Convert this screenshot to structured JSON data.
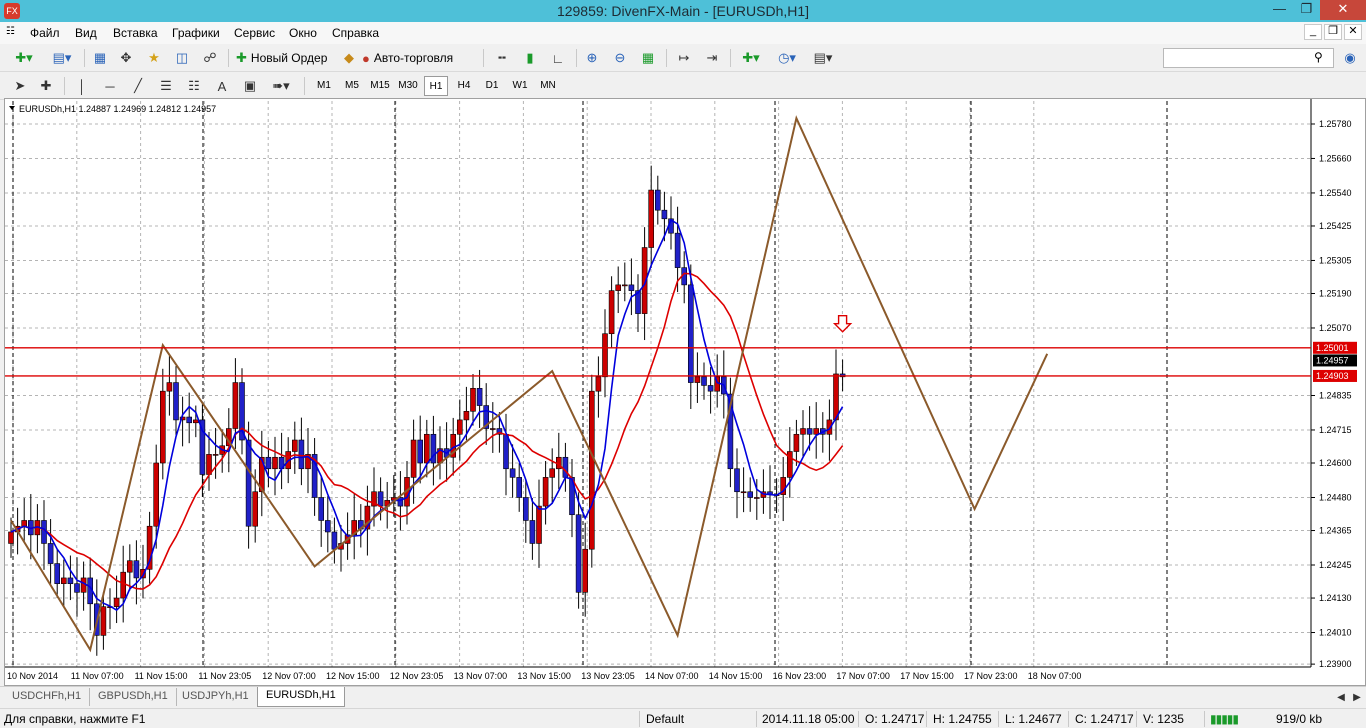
{
  "window": {
    "title": "129859: DivenFX-Main - [EURUSDh,H1]",
    "app_icon": "FX"
  },
  "menu": [
    "Файл",
    "Вид",
    "Вставка",
    "Графики",
    "Сервис",
    "Окно",
    "Справка"
  ],
  "toolbar": {
    "new_order": "Новый Ордер",
    "autotrading": "Авто-торговля"
  },
  "timeframes": [
    "M1",
    "M5",
    "M15",
    "M30",
    "H1",
    "H4",
    "D1",
    "W1",
    "MN"
  ],
  "active_timeframe": "H1",
  "search": {
    "placeholder": ""
  },
  "chart": {
    "header": "EURUSDh,H1  1.24887 1.24969 1.24812 1.24957",
    "hlines": [
      1.25001,
      1.24903
    ],
    "hline_labels": [
      "1.25001",
      "1.24903"
    ],
    "bid_label": "1.24957",
    "colors": {
      "bull": "#ffffff",
      "bear": "#cc0000",
      "fast_ma": "#0000dd",
      "slow_ma": "#dd0000",
      "zigzag": "#8b5a2b",
      "line": "#dd0000"
    }
  },
  "chart_data": {
    "type": "candlestick",
    "symbol": "EURUSDh",
    "timeframe": "H1",
    "ylim": [
      1.2389,
      1.2586
    ],
    "y_ticks": [
      "1.25780",
      "1.25660",
      "1.25540",
      "1.25425",
      "1.25305",
      "1.25190",
      "1.25070",
      "1.24835",
      "1.24715",
      "1.24600",
      "1.24480",
      "1.24365",
      "1.24245",
      "1.24130",
      "1.24010",
      "1.23900"
    ],
    "x_ticks": [
      "10 Nov 2014",
      "11 Nov 07:00",
      "11 Nov 15:00",
      "11 Nov 23:05",
      "12 Nov 07:00",
      "12 Nov 15:00",
      "12 Nov 23:05",
      "13 Nov 07:00",
      "13 Nov 15:00",
      "13 Nov 23:05",
      "14 Nov 07:00",
      "14 Nov 15:00",
      "16 Nov 23:00",
      "17 Nov 07:00",
      "17 Nov 15:00",
      "17 Nov 23:00",
      "18 Nov 07:00"
    ],
    "closes": [
      1.2436,
      1.2438,
      1.244,
      1.2435,
      1.244,
      1.2432,
      1.2425,
      1.2418,
      1.242,
      1.2418,
      1.2415,
      1.242,
      1.2411,
      1.24,
      1.241,
      1.241,
      1.2413,
      1.2422,
      1.2426,
      1.242,
      1.2423,
      1.2438,
      1.246,
      1.2485,
      1.2488,
      1.2475,
      1.2476,
      1.2474,
      1.2475,
      1.2456,
      1.2463,
      1.2463,
      1.2466,
      1.2472,
      1.2488,
      1.2468,
      1.2438,
      1.245,
      1.2462,
      1.2458,
      1.2462,
      1.2458,
      1.2464,
      1.2468,
      1.2458,
      1.2463,
      1.2448,
      1.244,
      1.2436,
      1.243,
      1.2432,
      1.2435,
      1.244,
      1.2437,
      1.2445,
      1.245,
      1.2445,
      1.2447,
      1.2448,
      1.2445,
      1.2455,
      1.2468,
      1.246,
      1.247,
      1.246,
      1.2465,
      1.2462,
      1.247,
      1.2475,
      1.2478,
      1.2486,
      1.248,
      1.2472,
      1.2472,
      1.247,
      1.2458,
      1.2455,
      1.2448,
      1.244,
      1.2432,
      1.2445,
      1.2455,
      1.2458,
      1.2462,
      1.2455,
      1.2442,
      1.2415,
      1.243,
      1.2485,
      1.249,
      1.2505,
      1.252,
      1.2522,
      1.2522,
      1.252,
      1.2512,
      1.2535,
      1.2555,
      1.2548,
      1.2545,
      1.254,
      1.2528,
      1.2522,
      1.2488,
      1.249,
      1.2487,
      1.2485,
      1.249,
      1.2484,
      1.2458,
      1.245,
      1.245,
      1.2448,
      1.2448,
      1.245,
      1.2449,
      1.2449,
      1.2455,
      1.2464,
      1.247,
      1.2472,
      1.247,
      1.2472,
      1.247,
      1.2475,
      1.2491,
      1.249
    ],
    "opens_note": "",
    "zigzag": [
      [
        0,
        1.244
      ],
      [
        12,
        1.2395
      ],
      [
        23,
        1.2501
      ],
      [
        46,
        1.2424
      ],
      [
        82,
        1.2492
      ],
      [
        101,
        1.24
      ],
      [
        119,
        1.258
      ],
      [
        146,
        1.2444
      ],
      [
        157,
        1.2498
      ]
    ],
    "fast_ma_period": "",
    "slow_ma_period": ""
  },
  "tabs": [
    "USDCHFh,H1",
    "GBPUSDh,H1",
    "USDJPYh,H1",
    "EURUSDh,H1"
  ],
  "active_tab": "EURUSDh,H1",
  "status": {
    "help": "Для справки, нажмите F1",
    "profile": "Default",
    "datetime": "2014.11.18 05:00",
    "open": "O: 1.24717",
    "high": "H: 1.24755",
    "low": "L: 1.24677",
    "close": "C: 1.24717",
    "volume": "V: 1235",
    "traffic": "919/0 kb"
  }
}
